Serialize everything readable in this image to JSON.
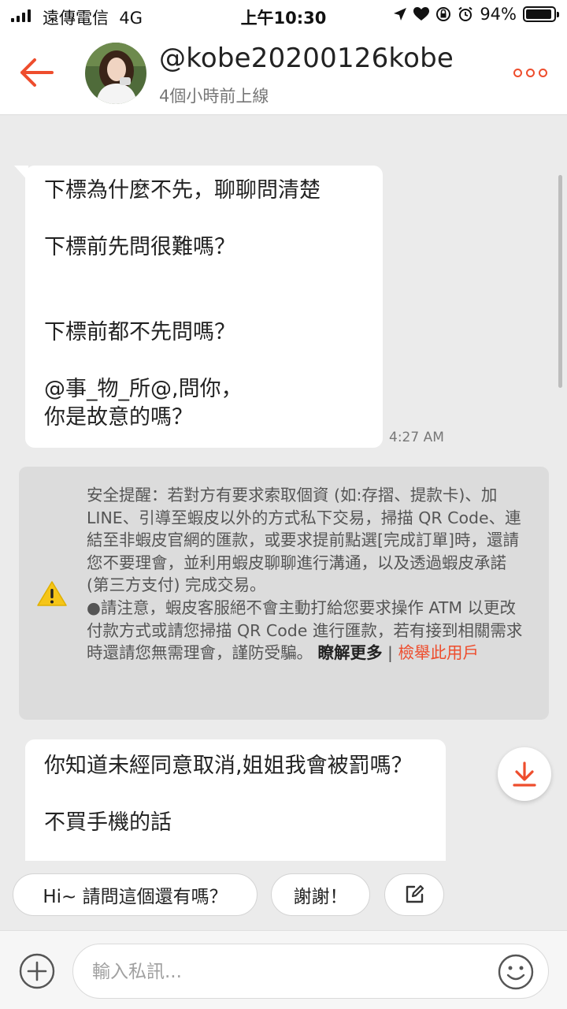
{
  "status_bar": {
    "carrier": "遠傳電信",
    "network": "4G",
    "time": "上午10:30",
    "battery": "94%",
    "battery_level": 0.94
  },
  "header": {
    "username": "@kobe20200126kobe",
    "last_seen": "4個小時前上線"
  },
  "messages": [
    {
      "text": "下標為什麼不先，聊聊問清楚\n\n下標前先問很難嗎？\n\n\n下標前都不先問嗎？\n\n@事_物_所@,問你，\n你是故意的嗎？",
      "time": "4:27 AM"
    },
    {
      "text": "你知道未經同意取消,姐姐我會被罰嗎？\n\n不買手機的話"
    }
  ],
  "safety_notice": {
    "text": "安全提醒：若對方有要求索取個資 (如:存摺、提款卡)、加 LINE、引導至蝦皮以外的方式私下交易，掃描 QR Code、連結至非蝦皮官網的匯款，或要求提前點選[完成訂單]時，還請您不要理會，並利用蝦皮聊聊進行溝通，以及透過蝦皮承諾 (第三方支付) 完成交易。\n●請注意，蝦皮客服絕不會主動打給您要求操作 ATM 以更改付款方式或請您掃描 QR Code 進行匯款，若有接到相關需求時還請您無需理會，謹防受騙。 ",
    "learn_more": "瞭解更多",
    "separator": " | ",
    "report": "檢舉此用戶"
  },
  "quick_replies": [
    "Hi~ 請問這個還有嗎？",
    "謝謝！"
  ],
  "input": {
    "placeholder": "輸入私訊..."
  },
  "colors": {
    "accent": "#ee4d2d",
    "warning": "#f5c518"
  }
}
